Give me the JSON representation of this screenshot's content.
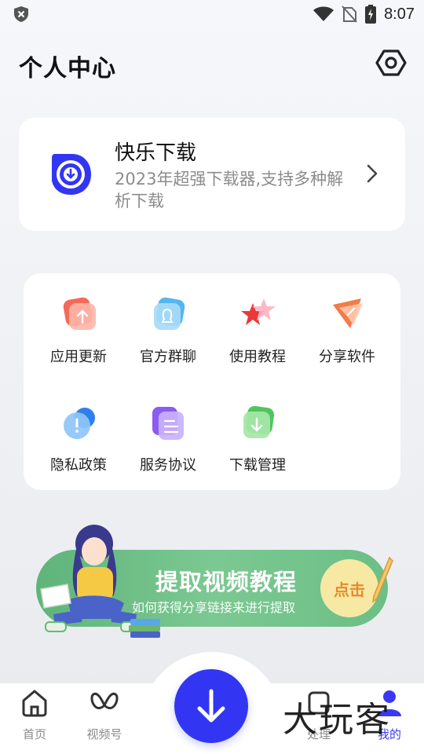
{
  "status_bar": {
    "time": "8:07"
  },
  "header": {
    "title": "个人中心"
  },
  "app_card": {
    "name": "快乐下载",
    "description": "2023年超强下载器,支持多种解析下载"
  },
  "grid": {
    "items": [
      {
        "label": "应用更新",
        "icon": "update-icon",
        "color": "#f46b57"
      },
      {
        "label": "官方群聊",
        "icon": "group-chat-icon",
        "color": "#55b6f0"
      },
      {
        "label": "使用教程",
        "icon": "tutorial-star-icon",
        "color": "#ef4a4a"
      },
      {
        "label": "分享软件",
        "icon": "share-plane-icon",
        "color": "#f47b4a"
      },
      {
        "label": "隐私政策",
        "icon": "privacy-icon",
        "color": "#3d97f0"
      },
      {
        "label": "服务协议",
        "icon": "agreement-icon",
        "color": "#8b5cf0"
      },
      {
        "label": "下载管理",
        "icon": "download-manage-icon",
        "color": "#4fc55e"
      }
    ]
  },
  "banner": {
    "title": "提取视频教程",
    "subtitle": "如何获得分享链接来进行提取",
    "button_label": "点击"
  },
  "bottom_nav": {
    "items": [
      {
        "label": "首页",
        "icon": "home-icon",
        "active": false
      },
      {
        "label": "视频号",
        "icon": "channels-icon",
        "active": false
      },
      {
        "label": "处理",
        "icon": "process-icon",
        "active": false
      },
      {
        "label": "我的",
        "icon": "profile-icon",
        "active": true
      }
    ],
    "fab_icon": "download-arrow-icon"
  },
  "watermark": "大玩客",
  "colors": {
    "accent": "#3236f2",
    "banner_green": "#6cbf86",
    "text_muted": "#8c8c8c"
  }
}
